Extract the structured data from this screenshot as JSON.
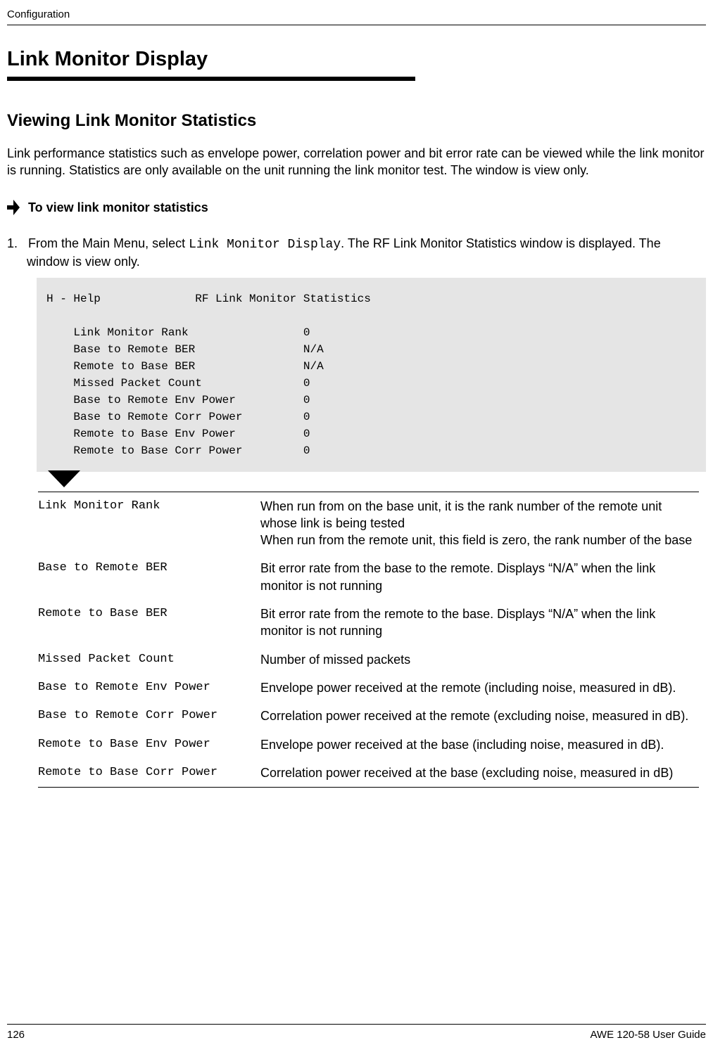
{
  "page": {
    "header": "Configuration",
    "h1": "Link Monitor Display",
    "h2": "Viewing Link Monitor Statistics",
    "intro": "Link performance statistics such as envelope power, correlation power and bit error rate can be viewed while the link monitor is running. Statistics are only available on the unit running the link monitor test. The window is view only.",
    "proc_heading": "To view link monitor statistics",
    "step_prefix": "1.",
    "step_text_a": "From the Main Menu, select ",
    "step_mono": "Link Monitor Display",
    "step_text_b": ". The RF Link Monitor Statistics window is displayed. The window is view only.",
    "footer_page": "126",
    "footer_guide": "AWE 120-58 User Guide"
  },
  "terminal": {
    "help": "H - Help",
    "title": "RF Link Monitor Statistics",
    "rows": [
      {
        "label": "Link Monitor Rank",
        "value": "0"
      },
      {
        "label": "Base to Remote BER",
        "value": "N/A"
      },
      {
        "label": "Remote to Base BER",
        "value": "N/A"
      },
      {
        "label": "Missed Packet Count",
        "value": "0"
      },
      {
        "label": "Base to Remote Env Power",
        "value": "0"
      },
      {
        "label": "Base to Remote Corr Power",
        "value": "0"
      },
      {
        "label": "Remote to Base Env Power",
        "value": "0"
      },
      {
        "label": "Remote to Base Corr Power",
        "value": "0"
      }
    ]
  },
  "defs": [
    {
      "term": "Link Monitor Rank",
      "desc": "When run from on the base unit, it is the rank number of the remote unit whose link is being tested\nWhen run from the remote unit, this field is zero, the rank number of the base"
    },
    {
      "term": "Base to Remote BER",
      "desc": "Bit error rate from the base to the remote. Displays “N/A” when the link monitor is not running"
    },
    {
      "term": "Remote to Base BER",
      "desc": "Bit error rate from the remote to the base. Displays “N/A” when the link monitor is not running"
    },
    {
      "term": "Missed Packet Count",
      "desc": "Number of missed packets"
    },
    {
      "term": "Base to Remote Env Power",
      "desc": "Envelope power received at the remote (including noise, measured in dB)."
    },
    {
      "term": "Base to Remote Corr Power",
      "desc": "Correlation power received at the remote (excluding noise, measured in dB)."
    },
    {
      "term": "Remote to Base Env Power",
      "desc": "Envelope power received at the base (including noise, measured in dB)."
    },
    {
      "term": "Remote to Base Corr Power",
      "desc": "Correlation power received at the base (excluding noise, measured in dB)"
    }
  ]
}
